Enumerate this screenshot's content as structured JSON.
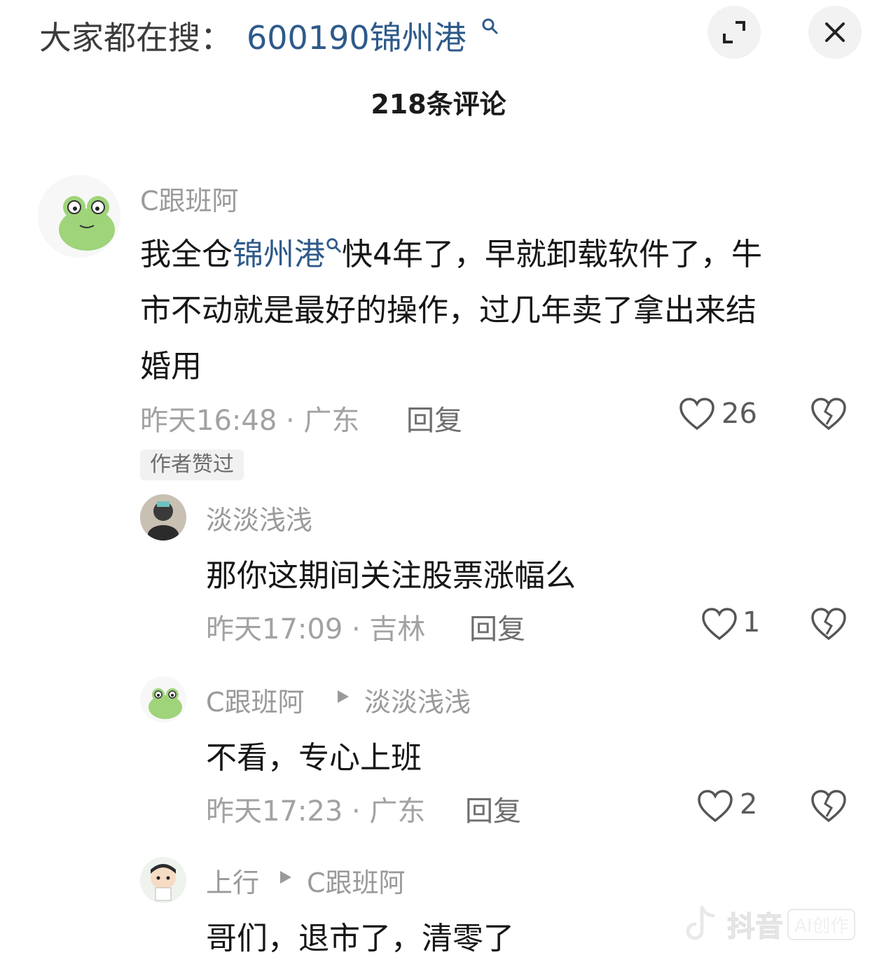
{
  "header": {
    "search_prefix": "大家都在搜：",
    "search_term": "600190锦州港",
    "expand_icon": "expand-icon",
    "close_icon": "close-icon"
  },
  "comment_count": "218条评论",
  "comments": [
    {
      "username": "C跟班阿",
      "text_before": "我全仓",
      "text_link": "锦州港",
      "text_after_line1": "快4年了，早就卸载软件了，牛",
      "text_line2": "市不动就是最好的操作，过几年卖了拿出来结",
      "text_line3": "婚用",
      "time_location": "昨天16:48 · 广东",
      "reply": "回复",
      "likes": "26",
      "badge": "作者赞过"
    },
    {
      "username": "淡淡浅浅",
      "text": "那你这期间关注股票涨幅么",
      "time_location": "昨天17:09 · 吉林",
      "reply": "回复",
      "likes": "1"
    },
    {
      "username": "C跟班阿",
      "reply_to": "淡淡浅浅",
      "text": "不看，专心上班",
      "time_location": "昨天17:23 · 广东",
      "reply": "回复",
      "likes": "2"
    },
    {
      "username": "上行",
      "reply_to": "C跟班阿",
      "text": "哥们，退市了，清零了"
    }
  ],
  "watermark": {
    "brand": "抖音",
    "badge": "AI创作"
  },
  "colors": {
    "link": "#2e5a8a",
    "meta": "#a2a2a2",
    "text": "#161616"
  }
}
